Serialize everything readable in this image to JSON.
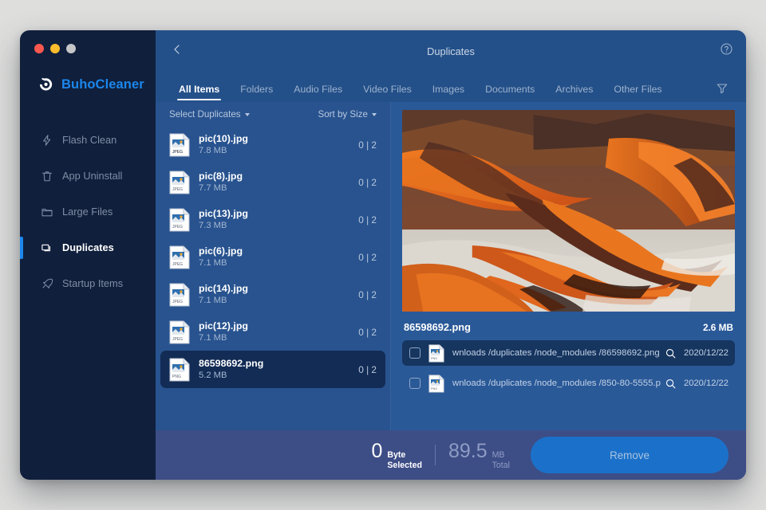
{
  "window": {
    "traffic_lights": [
      "close",
      "minimize",
      "zoom"
    ]
  },
  "sidebar": {
    "brand": "BuhoCleaner",
    "items": [
      {
        "label": "Flash Clean",
        "icon": "bolt-icon",
        "active": false
      },
      {
        "label": "App Uninstall",
        "icon": "trash-icon",
        "active": false
      },
      {
        "label": "Large Files",
        "icon": "folder-icon",
        "active": false
      },
      {
        "label": "Duplicates",
        "icon": "duplicates-icon",
        "active": true
      },
      {
        "label": "Startup Items",
        "icon": "rocket-icon",
        "active": false
      }
    ]
  },
  "header": {
    "title": "Duplicates",
    "back_icon": "chevron-left-icon",
    "help_icon": "help-circle-icon"
  },
  "tabs": {
    "items": [
      "All Items",
      "Folders",
      "Audio Files",
      "Video Files",
      "Images",
      "Documents",
      "Archives",
      "Other Files"
    ],
    "active": "All Items",
    "filter_icon": "filter-icon"
  },
  "list": {
    "select_dropdown": "Select Duplicates",
    "sort_dropdown": "Sort by Size",
    "rows": [
      {
        "name": "pic(10).jpg",
        "size": "7.8 MB",
        "count": "0 | 2",
        "type": "JPEG",
        "selected": false
      },
      {
        "name": "pic(8).jpg",
        "size": "7.7 MB",
        "count": "0 | 2",
        "type": "JPEG",
        "selected": false
      },
      {
        "name": "pic(13).jpg",
        "size": "7.3 MB",
        "count": "0 | 2",
        "type": "JPEG",
        "selected": false
      },
      {
        "name": "pic(6).jpg",
        "size": "7.1 MB",
        "count": "0 | 2",
        "type": "JPEG",
        "selected": false
      },
      {
        "name": "pic(14).jpg",
        "size": "7.1 MB",
        "count": "0 | 2",
        "type": "JPEG",
        "selected": false
      },
      {
        "name": "pic(12).jpg",
        "size": "7.1 MB",
        "count": "0 | 2",
        "type": "JPEG",
        "selected": false
      },
      {
        "name": "86598692.png",
        "size": "5.2 MB",
        "count": "0 | 2",
        "type": "PNG",
        "selected": true
      }
    ]
  },
  "detail": {
    "preview_alt": "aerial-photo-of-orange-sand-dunes",
    "name": "86598692.png",
    "size": "2.6 MB",
    "rows": [
      {
        "path": "wnloads /duplicates /node_modules /86598692.png",
        "date": "2020/12/22",
        "type": "PNG",
        "highlight": true,
        "checked": false
      },
      {
        "path": "wnloads /duplicates /node_modules /850-80-5555.p",
        "date": "2020/12/22",
        "type": "PNG",
        "highlight": false,
        "checked": false
      }
    ],
    "search_icon": "magnifier-icon"
  },
  "footer": {
    "selected_value": "0",
    "selected_unit": "Byte",
    "selected_label": "Selected",
    "total_value": "89.5",
    "total_unit": "MB",
    "total_label": "Total",
    "remove_label": "Remove"
  },
  "colors": {
    "accent": "#1b87ec",
    "sidebar_bg": "#101f3c",
    "main_bg": "#245089",
    "list_bg": "#28538f",
    "detail_bg": "#2a5998",
    "footer_bg": "#3d4d86",
    "remove_btn": "#1b71c9",
    "selected_row": "#132c55"
  }
}
